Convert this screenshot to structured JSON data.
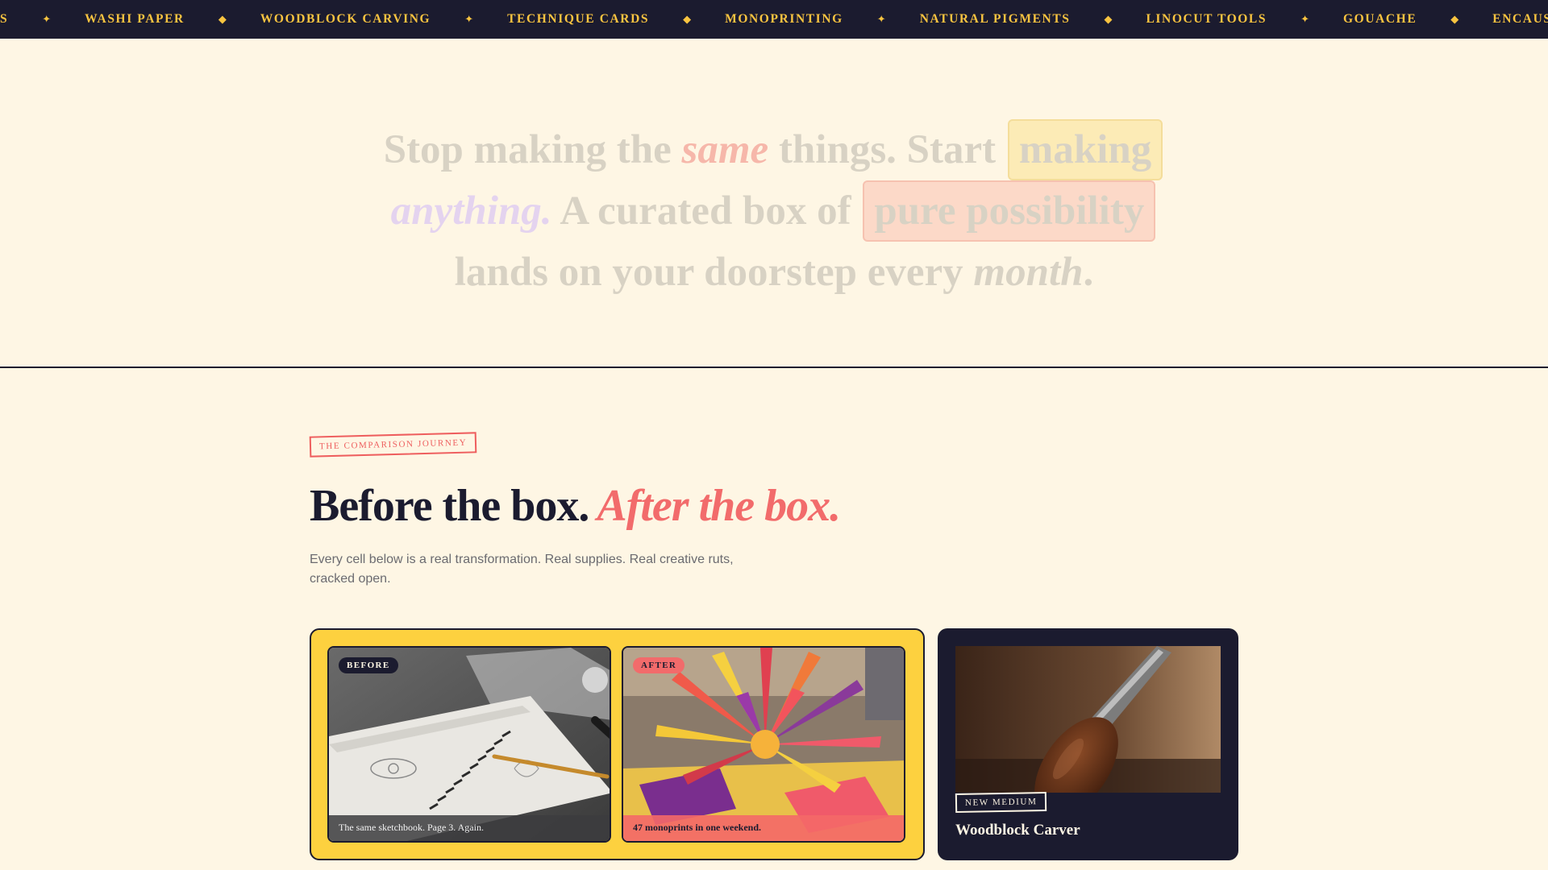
{
  "ticker": {
    "items": [
      {
        "label": "S",
        "sep": "✦"
      },
      {
        "label": "WASHI PAPER",
        "sep": "◆"
      },
      {
        "label": "WOODBLOCK CARVING",
        "sep": "✦"
      },
      {
        "label": "TECHNIQUE CARDS",
        "sep": "◆"
      },
      {
        "label": "MONOPRINTING",
        "sep": "✦"
      },
      {
        "label": "NATURAL PIGMENTS",
        "sep": "◆"
      },
      {
        "label": "LINOCUT TOOLS",
        "sep": "✦"
      },
      {
        "label": "GOUACHE",
        "sep": "◆"
      },
      {
        "label": "ENCAUSTIC WAX",
        "sep": ""
      }
    ]
  },
  "hero": {
    "p1": "Stop making the ",
    "same": "same",
    "p2": " things. Start ",
    "making": "making",
    "anything": "anything.",
    "p3": " A curated box of ",
    "pure": "pure possibility",
    "p4": "lands on your doorstep every ",
    "month": "month",
    "end": "."
  },
  "comparison": {
    "tag": "THE COMPARISON JOURNEY",
    "title_main": "Before the box.",
    "title_accent": "After the box.",
    "subtitle": "Every cell below is a real transformation. Real supplies. Real creative ruts, cracked open.",
    "before_badge": "BEFORE",
    "before_caption": "The same sketchbook. Page 3. Again.",
    "after_badge": "AFTER",
    "after_caption": "47 monoprints in one weekend."
  },
  "medium_card": {
    "badge": "NEW MEDIUM",
    "title": "Woodblock Carver"
  },
  "colors": {
    "navy": "#1b1b2f",
    "cream": "#fef6e4",
    "yellow": "#fdd13f",
    "coral": "#f26b6b",
    "gold": "#f9c440"
  }
}
